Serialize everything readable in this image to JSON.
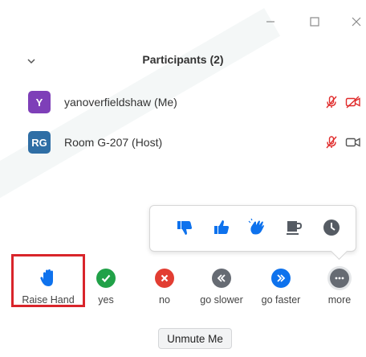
{
  "window": {
    "controls": [
      "minimize-icon",
      "maximize-icon",
      "close-icon"
    ]
  },
  "panel": {
    "title": "Participants (2)",
    "collapse_icon": "chevron-down-icon"
  },
  "participants": [
    {
      "initials": "Y",
      "name": "yanoverfieldshaw (Me)",
      "avatar_color": "#7e3fb8",
      "icons": [
        "mic-muted-icon",
        "video-off-icon"
      ],
      "status_color": "#e02b2b"
    },
    {
      "initials": "RG",
      "name": "Room G-207 (Host)",
      "avatar_color": "#2f6ea5",
      "icons": [
        "mic-muted-icon",
        "video-icon"
      ],
      "status_color": "#e02b2b"
    }
  ],
  "reactions_popup": {
    "items": [
      "thumbs-down-icon",
      "thumbs-up-icon",
      "clap-icon",
      "coffee-icon",
      "clock-icon"
    ],
    "color": "#0e72ed"
  },
  "feedback_buttons": [
    {
      "label": "Raise Hand",
      "icon": "raised-hand-icon",
      "color": "#0e72ed"
    },
    {
      "label": "yes",
      "icon": "check-icon",
      "color": "#21a148"
    },
    {
      "label": "no",
      "icon": "x-icon",
      "color": "#e23d32"
    },
    {
      "label": "go slower",
      "icon": "double-chevron-left-icon",
      "color": "#666b73"
    },
    {
      "label": "go faster",
      "icon": "double-chevron-right-icon",
      "color": "#0e72ed"
    },
    {
      "label": "more",
      "icon": "more-dots-icon",
      "color": "#666b73"
    }
  ],
  "unmute_button": {
    "label": "Unmute Me"
  },
  "highlight_color": "#d9252b"
}
